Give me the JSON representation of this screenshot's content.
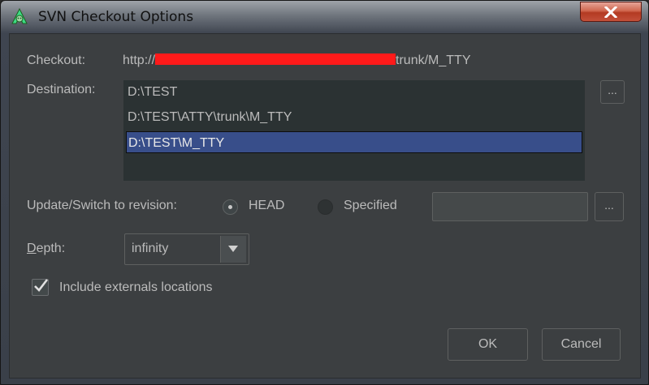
{
  "window": {
    "title": "SVN Checkout Options",
    "close_glyph": "×"
  },
  "checkout": {
    "label": "Checkout:",
    "url_prefix": "http://",
    "url_suffix": "trunk/M_TTY"
  },
  "destination": {
    "label": "Destination:",
    "browse_label": "...",
    "items": [
      "D:\\TEST",
      "D:\\TEST\\ATTY\\trunk\\M_TTY",
      "D:\\TEST\\M_TTY"
    ],
    "selected_index": 2
  },
  "revision": {
    "label": "Update/Switch to revision:",
    "head_label": "HEAD",
    "head_checked": true,
    "specified_label": "Specified",
    "specified_checked": false,
    "specified_value": "",
    "browse_label": "..."
  },
  "depth": {
    "label": "Depth:",
    "label_mnemonic": "D",
    "label_rest": "epth:",
    "value": "infinity"
  },
  "externals": {
    "label": "Include externals locations",
    "checked": true
  },
  "buttons": {
    "ok": "OK",
    "cancel": "Cancel"
  },
  "colors": {
    "selection": "#384e8a",
    "redaction": "#ff1a1a",
    "background": "#3c3f41",
    "text": "#bbbbbb"
  },
  "icons": {
    "app": "android-studio-icon",
    "close": "close-icon",
    "dropdown": "triangle-down-icon",
    "check": "checkmark-icon"
  }
}
